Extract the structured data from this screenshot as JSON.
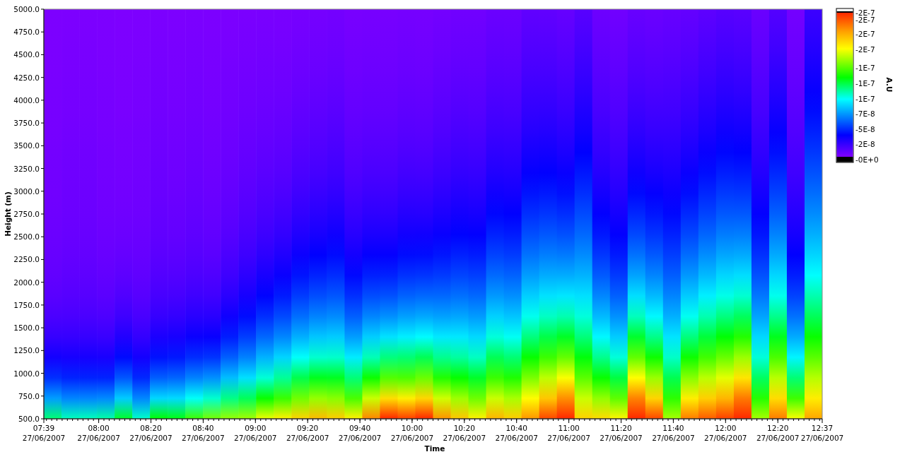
{
  "heatmap": {
    "ylabel": "Height (m)",
    "xlabel": "Time",
    "yticks": [
      "5000.0",
      "4750.0",
      "4500.0",
      "4250.0",
      "4000.0",
      "3750.0",
      "3500.0",
      "3250.0",
      "3000.0",
      "2750.0",
      "2500.0",
      "2250.0",
      "2000.0",
      "1750.0",
      "1500.0",
      "1250.0",
      "1000.0",
      "750.0",
      "500.0"
    ],
    "xticks": [
      {
        "time": "07:39",
        "date": "27/06/2007"
      },
      {
        "time": "08:00",
        "date": "27/06/2007"
      },
      {
        "time": "08:20",
        "date": "27/06/2007"
      },
      {
        "time": "08:40",
        "date": "27/06/2007"
      },
      {
        "time": "09:00",
        "date": "27/06/2007"
      },
      {
        "time": "09:20",
        "date": "27/06/2007"
      },
      {
        "time": "09:40",
        "date": "27/06/2007"
      },
      {
        "time": "10:00",
        "date": "27/06/2007"
      },
      {
        "time": "10:20",
        "date": "27/06/2007"
      },
      {
        "time": "10:40",
        "date": "27/06/2007"
      },
      {
        "time": "11:00",
        "date": "27/06/2007"
      },
      {
        "time": "11:20",
        "date": "27/06/2007"
      },
      {
        "time": "11:40",
        "date": "27/06/2007"
      },
      {
        "time": "12:00",
        "date": "27/06/2007"
      },
      {
        "time": "12:20",
        "date": "27/06/2007"
      },
      {
        "time": "12:37",
        "date": "27/06/2007"
      }
    ]
  },
  "colorbar": {
    "label": "A.U",
    "ticks": [
      "-2E-7",
      "-2E-7",
      "-2E-7",
      "-2E-7",
      "-1E-7",
      "-1E-7",
      "-1E-7",
      "-7E-8",
      "-5E-8",
      "-2E-8",
      "-0E+0"
    ]
  }
}
